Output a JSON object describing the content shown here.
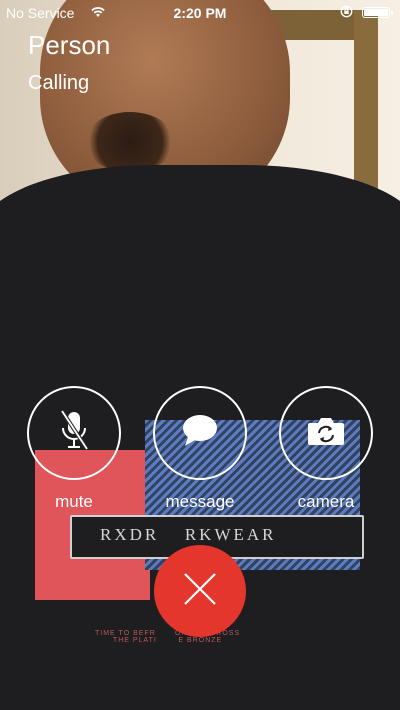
{
  "status_bar": {
    "carrier": "No Service",
    "time": "2:20 PM",
    "icons": [
      "wifi-icon",
      "orientation-lock-icon",
      "battery-icon"
    ]
  },
  "call": {
    "name": "Person",
    "status": "Calling"
  },
  "controls": [
    {
      "label": "mute",
      "icon": "microphone-muted-icon"
    },
    {
      "label": "message",
      "icon": "message-bubble-icon"
    },
    {
      "label": "camera",
      "icon": "camera-switch-icon"
    }
  ],
  "end_call": {
    "icon": "close-icon",
    "color": "#e5362e"
  },
  "background_print": {
    "text": "RXDR    RKWEAR",
    "small_text": "TIME TO BEFR        ON THE CROSS\nTHE PLATI         E BRONZE"
  }
}
